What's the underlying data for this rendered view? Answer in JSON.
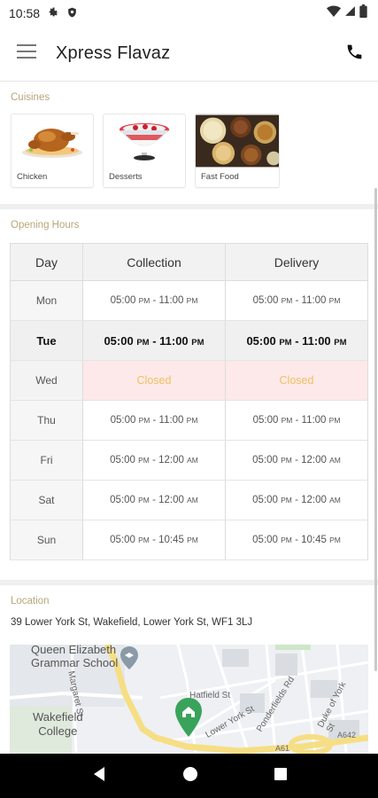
{
  "status_bar": {
    "time": "10:58"
  },
  "app_bar": {
    "title": "Xpress Flavaz"
  },
  "cuisines": {
    "label": "Cuisines",
    "items": [
      {
        "name": "Chicken"
      },
      {
        "name": "Desserts"
      },
      {
        "name": "Fast Food"
      }
    ]
  },
  "hours": {
    "label": "Opening Hours",
    "headers": [
      "Day",
      "Collection",
      "Delivery"
    ],
    "rows": [
      {
        "day": "Mon",
        "collection": "05:00 PM - 11:00 PM",
        "delivery": "05:00 PM - 11:00 PM",
        "today": false,
        "closed": false
      },
      {
        "day": "Tue",
        "collection": "05:00 PM - 11:00 PM",
        "delivery": "05:00 PM - 11:00 PM",
        "today": true,
        "closed": false
      },
      {
        "day": "Wed",
        "collection": "Closed",
        "delivery": "Closed",
        "today": false,
        "closed": true
      },
      {
        "day": "Thu",
        "collection": "05:00 PM - 11:00 PM",
        "delivery": "05:00 PM - 11:00 PM",
        "today": false,
        "closed": false
      },
      {
        "day": "Fri",
        "collection": "05:00 PM - 12:00 AM",
        "delivery": "05:00 PM - 12:00 AM",
        "today": false,
        "closed": false
      },
      {
        "day": "Sat",
        "collection": "05:00 PM - 12:00 AM",
        "delivery": "05:00 PM - 12:00 AM",
        "today": false,
        "closed": false
      },
      {
        "day": "Sun",
        "collection": "05:00 PM - 10:45 PM",
        "delivery": "05:00 PM - 10:45 PM",
        "today": false,
        "closed": false
      }
    ]
  },
  "location": {
    "label": "Location",
    "address": "39 Lower York St, Wakefield, Lower York St, WF1 3LJ",
    "map_labels": {
      "school": "Queen Elizabeth Grammar School",
      "school_line1": "Queen Elizabeth",
      "school_line2": "Grammar School",
      "college_line1": "Wakefield",
      "college_line2": "College",
      "hatfield": "Hatfield St",
      "lower_york": "Lower York St",
      "ponderfield": "Ponderfields Rd",
      "duke": "Duke of York St",
      "a642": "A642",
      "a61": "A61",
      "margaret": "Margaret St"
    }
  },
  "colors": {
    "accent_label": "#b8a67a",
    "closed_bg": "#fde9ea",
    "closed_text": "#f0c060"
  }
}
